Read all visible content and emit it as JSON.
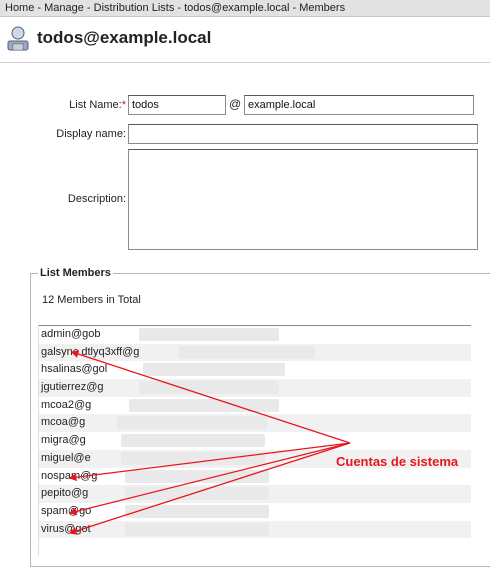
{
  "breadcrumb": "Home - Manage - Distribution Lists - todos@example.local - Members",
  "page_title": "todos@example.local",
  "form": {
    "list_name_label": "List Name:",
    "required_mark": "*",
    "list_name_value": "todos",
    "at_sign": "@",
    "domain_value": "example.local",
    "display_name_label": "Display name:",
    "display_name_value": "",
    "description_label": "Description:",
    "description_value": ""
  },
  "members": {
    "legend": "List Members",
    "total_text": "12 Members in Total",
    "items": [
      "admin@gob",
      "galsync.dtlyq3xff@g",
      "hsalinas@gol",
      "jgutierrez@g",
      "mcoa2@g",
      "mcoa@g",
      "migra@g",
      "miguel@e",
      "nospam@g",
      "pepito@g",
      "spam@go",
      "virus@got"
    ]
  },
  "annotation": {
    "text": "Cuentas de sistema",
    "color": "#e8161c"
  },
  "icons": {
    "title": "distribution-list-icon"
  }
}
